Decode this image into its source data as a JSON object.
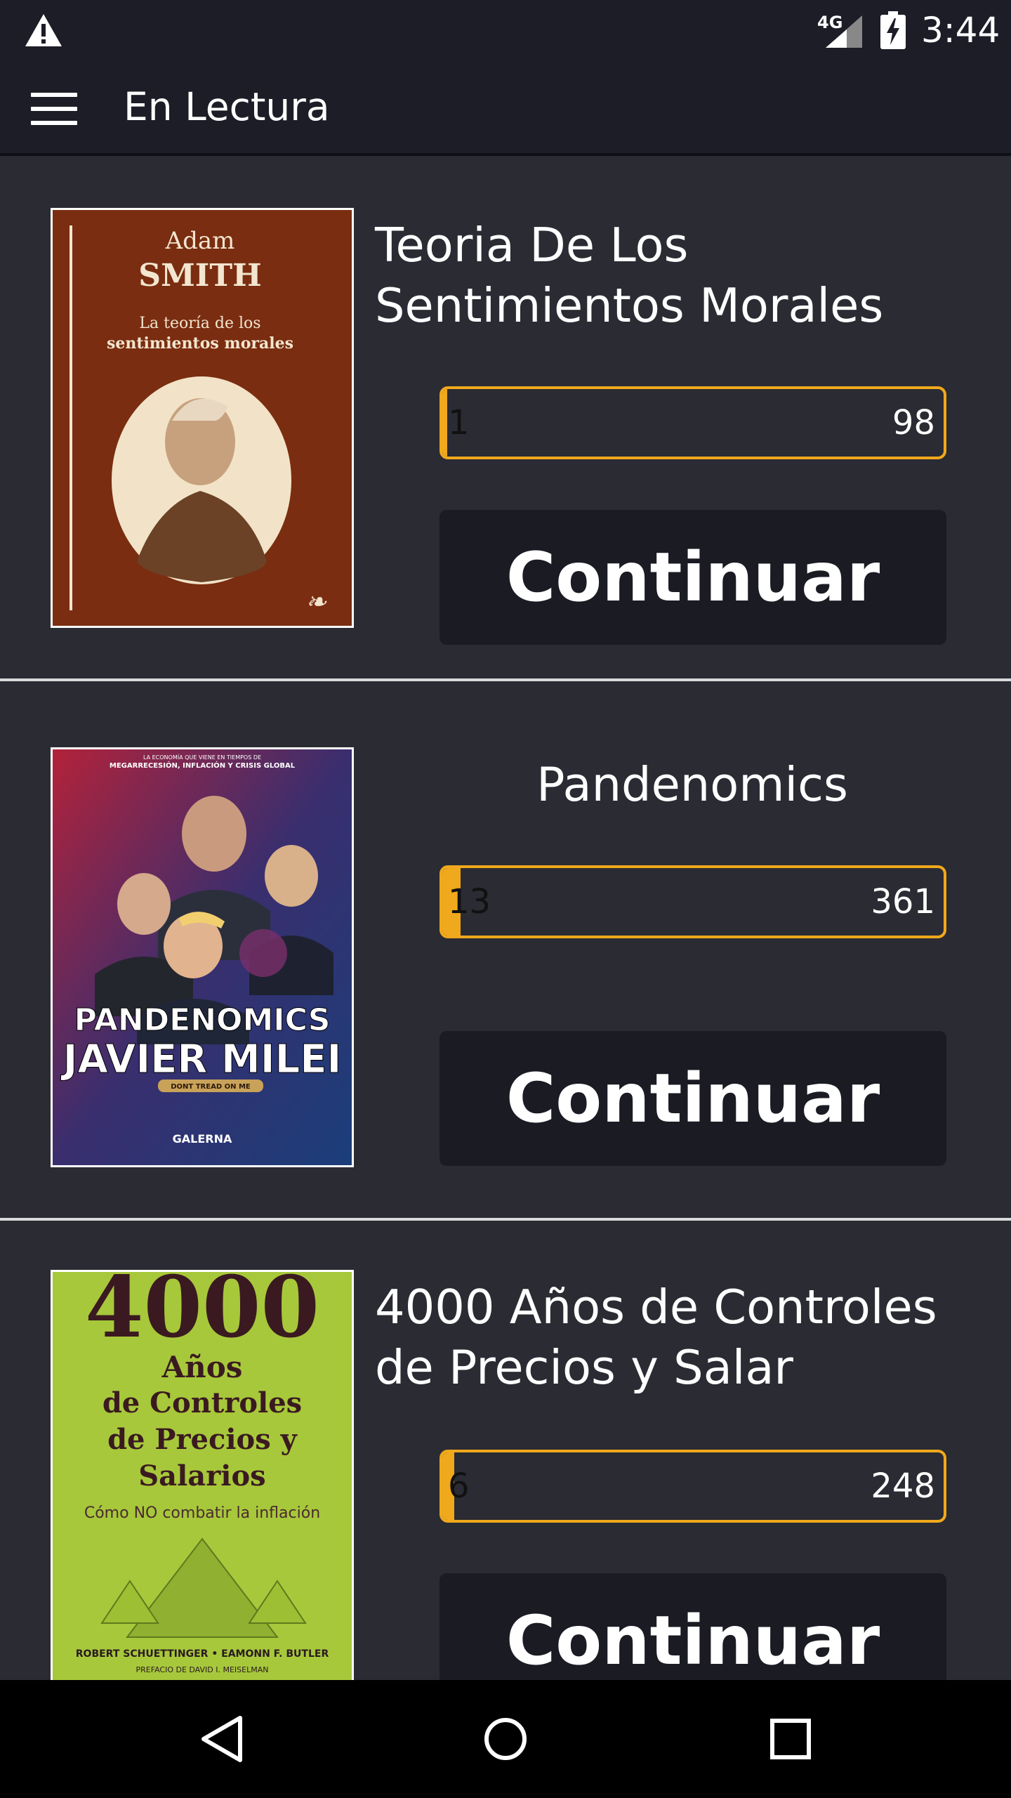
{
  "status_bar": {
    "network": "4G",
    "time": "3:44",
    "icons": [
      "warning-icon",
      "signal-icon",
      "battery-charging-icon"
    ]
  },
  "app_bar": {
    "title": "En Lectura",
    "menu_icon": "hamburger-menu-icon"
  },
  "books": [
    {
      "title": "Teoria De Los Sentimientos Morales",
      "current_page": "1",
      "total_pages": "98",
      "progress": 0.0102,
      "button_label": "Continuar",
      "cover": {
        "author_first": "Adam",
        "author_last": "SMITH",
        "line1": "La teoría de los",
        "line2": "sentimientos morales",
        "bg_color": "#7a2d10"
      }
    },
    {
      "title": "Pandenomics",
      "current_page": "13",
      "total_pages": "361",
      "progress": 0.036,
      "button_label": "Continuar",
      "cover": {
        "kicker1": "LA ECONOMÍA QUE VIENE EN TIEMPOS DE",
        "kicker2": "MEGARRECESIÓN, INFLACIÓN Y CRISIS GLOBAL",
        "big1": "PANDENOMICS",
        "big2": "JAVIER MILEI",
        "tag": "DONT TREAD ON ME",
        "publisher": "GALERNA",
        "bg_color": "#3a2e6e"
      }
    },
    {
      "title": "4000 Años de Controles de Precios y Salar",
      "current_page": "6",
      "total_pages": "248",
      "progress": 0.024,
      "button_label": "Continuar",
      "cover": {
        "number": "4000",
        "line1": "Años",
        "line2": "de Controles",
        "line3": "de Precios y",
        "line4": "Salarios",
        "subtitle": "Cómo NO combatir la inflación",
        "authors": "ROBERT SCHUETTINGER • EAMONN F. BUTLER",
        "preface": "PREFACIO DE DAVID I. MEISELMAN",
        "bg_color": "#a7c83b"
      }
    }
  ],
  "colors": {
    "background": "#2a2b33",
    "bar": "#1c1d26",
    "accent": "#f0a81c",
    "button": "#1a1b23",
    "divider": "#d9d9d9"
  },
  "nav_bar": {
    "icons": [
      "back-icon",
      "home-icon",
      "recents-icon"
    ]
  }
}
